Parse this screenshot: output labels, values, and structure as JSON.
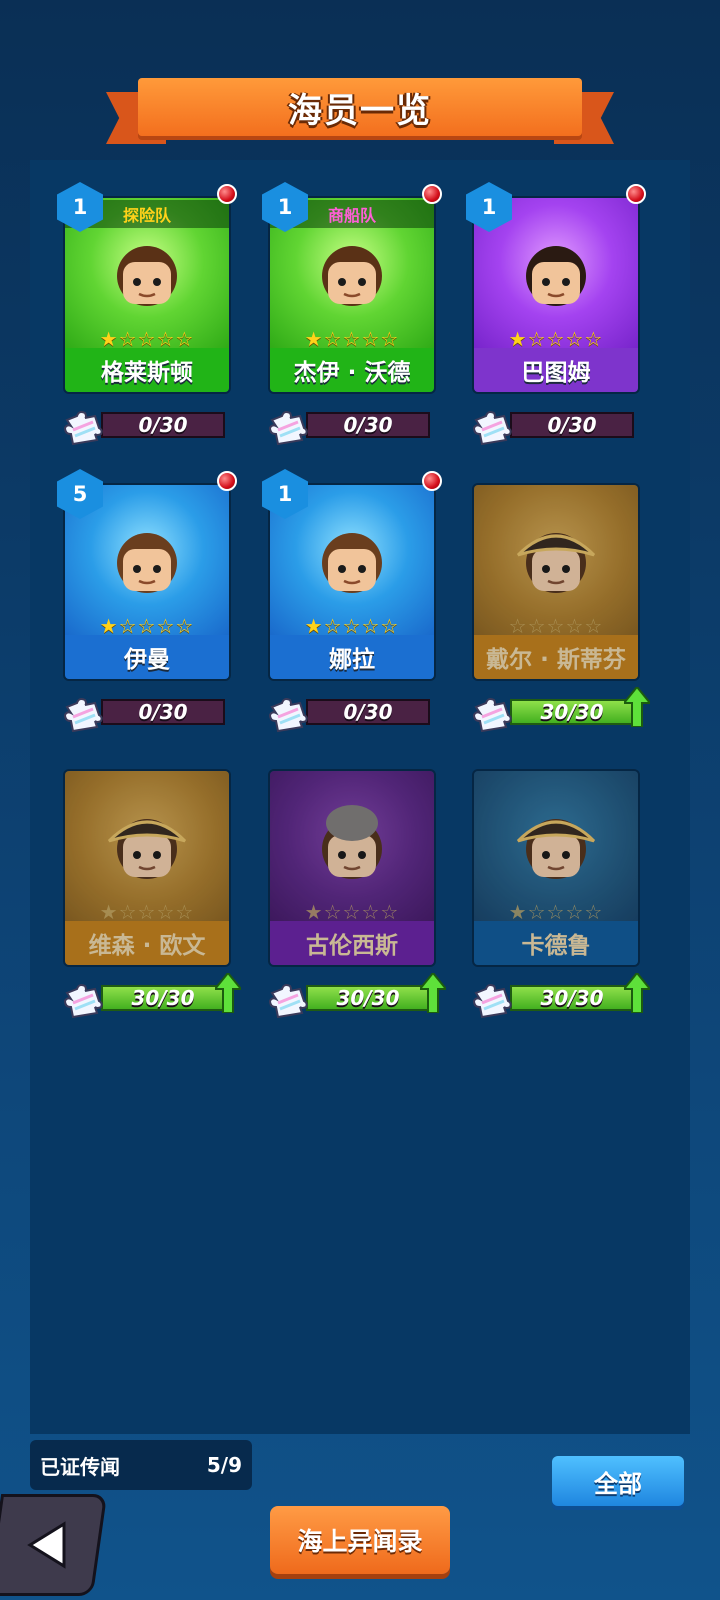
{
  "header": {
    "title": "海员一览"
  },
  "crew": [
    {
      "name": "格莱斯顿",
      "level": "1",
      "team": "探险队",
      "team_color": "#ffd21a",
      "stars": "★☆☆☆☆",
      "progress": "0/30",
      "theme": "green",
      "unlocked": true,
      "alert": true
    },
    {
      "name": "杰伊 · 沃德",
      "level": "1",
      "team": "商船队",
      "team_color": "#ff5fd7",
      "stars": "★☆☆☆☆",
      "progress": "0/30",
      "theme": "green",
      "unlocked": true,
      "alert": true
    },
    {
      "name": "巴图姆",
      "level": "1",
      "team": "",
      "stars": "★☆☆☆☆",
      "progress": "0/30",
      "theme": "purple",
      "unlocked": true,
      "alert": true
    },
    {
      "name": "伊曼",
      "level": "5",
      "team": "",
      "stars": "★☆☆☆☆",
      "progress": "0/30",
      "theme": "blue",
      "unlocked": true,
      "alert": true
    },
    {
      "name": "娜拉",
      "level": "1",
      "team": "",
      "stars": "★☆☆☆☆",
      "progress": "0/30",
      "theme": "blue",
      "unlocked": true,
      "alert": true
    },
    {
      "name": "戴尔 · 斯蒂芬",
      "level": "",
      "team": "",
      "stars": "☆☆☆☆☆",
      "progress": "30/30",
      "theme": "gold",
      "unlocked": false,
      "alert": false
    },
    {
      "name": "维森 · 欧文",
      "level": "",
      "team": "",
      "stars": "★☆☆☆☆",
      "progress": "30/30",
      "theme": "gold",
      "unlocked": false,
      "alert": false
    },
    {
      "name": "古伦西斯",
      "level": "",
      "team": "",
      "stars": "★☆☆☆☆",
      "progress": "30/30",
      "theme": "dpurple",
      "unlocked": false,
      "alert": false
    },
    {
      "name": "卡德鲁",
      "level": "",
      "team": "",
      "stars": "★☆☆☆☆",
      "progress": "30/30",
      "theme": "teal",
      "unlocked": false,
      "alert": false
    }
  ],
  "footer": {
    "legend_label": "已证传闻",
    "legend_count": "5/9",
    "filter_button": "全部",
    "sea_button": "海上异闻录"
  },
  "colors": {
    "accent": "#f36f1e",
    "panel": "#073864",
    "progress_full": "#43b020"
  }
}
